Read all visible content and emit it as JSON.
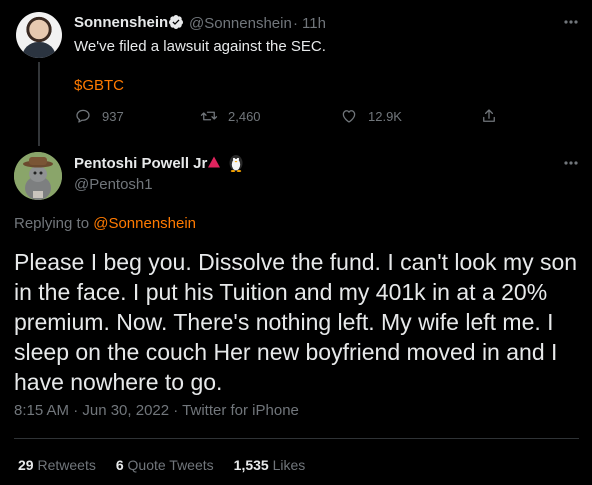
{
  "parent_tweet": {
    "display_name": "Sonnenshein",
    "handle": "@Sonnenshein",
    "separator": "·",
    "time": "11h",
    "text": "We've filed a lawsuit against the SEC.",
    "cashtag": "$GBTC",
    "actions": {
      "replies": "937",
      "retweets": "2,460",
      "likes": "12.9K"
    },
    "verified": true
  },
  "main_tweet": {
    "display_name": "Pentoshi Powell Jr",
    "handle": "@Pentosh1",
    "replying_prefix": "Replying to ",
    "replying_to": "@Sonnenshein",
    "body": "Please I beg you. Dissolve the fund. I can't look my son in the face. I put his Tuition and my 401k in at a 20% premium. Now. There's nothing left. My wife left me. I sleep on the couch Her new boyfriend moved in and I have nowhere to go.",
    "meta": "8:15 AM · Jun 30, 2022 · Twitter for iPhone",
    "stats": [
      {
        "count": "29",
        "label": "Retweets"
      },
      {
        "count": "6",
        "label": "Quote Tweets"
      },
      {
        "count": "1,535",
        "label": "Likes"
      }
    ]
  },
  "colors": {
    "background": "#000000",
    "text_primary": "#e7e9ea",
    "text_secondary": "#71767b",
    "accent": "#ff7a00",
    "verified": "#e7e9ea",
    "divider": "#2f3336"
  }
}
